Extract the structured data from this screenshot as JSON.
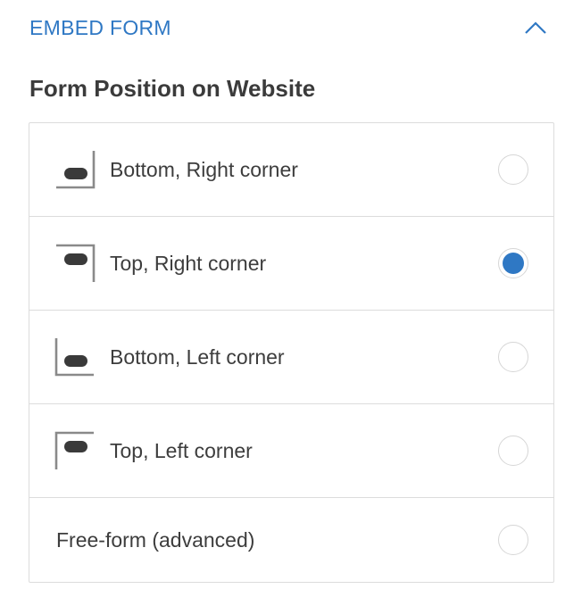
{
  "header": {
    "title": "EMBED FORM",
    "collapse_icon": "chevron-up-icon"
  },
  "section": {
    "title": "Form Position on Website"
  },
  "options": [
    {
      "label": "Bottom, Right corner",
      "icon": "bottom-right-corner-icon",
      "selected": false
    },
    {
      "label": "Top, Right corner",
      "icon": "top-right-corner-icon",
      "selected": true
    },
    {
      "label": "Bottom, Left corner",
      "icon": "bottom-left-corner-icon",
      "selected": false
    },
    {
      "label": "Top, Left corner",
      "icon": "top-left-corner-icon",
      "selected": false
    },
    {
      "label": "Free-form (advanced)",
      "icon": "",
      "selected": false
    }
  ],
  "colors": {
    "accent": "#2f78c4",
    "text": "#3d3d3d",
    "border": "#dcdcdc",
    "icon": "#8a8a8a",
    "icon_dark": "#3a3a3a"
  }
}
